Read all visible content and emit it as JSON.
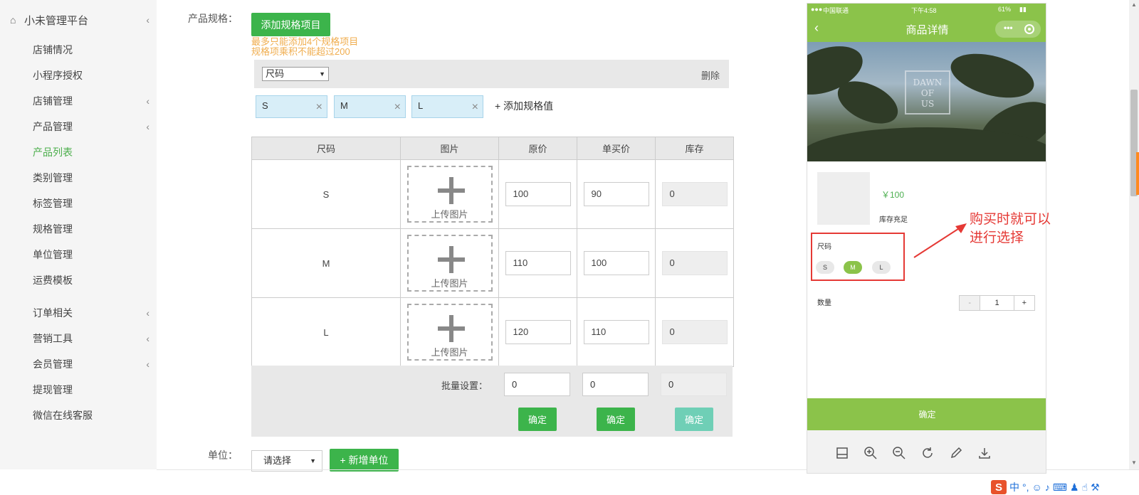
{
  "sidebar": {
    "brand": "小未管理平台",
    "items": [
      {
        "label": "店铺情况"
      },
      {
        "label": "小程序授权"
      },
      {
        "label": "店铺管理"
      },
      {
        "label": "产品管理"
      },
      {
        "label": "产品列表"
      },
      {
        "label": "类别管理"
      },
      {
        "label": "标签管理"
      },
      {
        "label": "规格管理"
      },
      {
        "label": "单位管理"
      },
      {
        "label": "运费模板"
      },
      {
        "label": "订单相关"
      },
      {
        "label": "营销工具"
      },
      {
        "label": "会员管理"
      },
      {
        "label": "提现管理"
      },
      {
        "label": "微信在线客服"
      }
    ]
  },
  "form": {
    "spec_label": "产品规格：",
    "add_spec_button": "添加规格项目",
    "hint_1": "最多只能添加4个规格项目",
    "hint_2": "规格项乘积不能超过200",
    "spec_select_value": "尺码",
    "delete_label": "删除",
    "tags": [
      "S",
      "M",
      "L"
    ],
    "add_value_label": "+ 添加规格值",
    "unit_label": "单位：",
    "unit_select_value": "请选择",
    "add_unit_button": "+ 新增单位"
  },
  "table": {
    "headers": [
      "尺码",
      "图片",
      "原价",
      "单买价",
      "库存"
    ],
    "upload_label": "上传图片",
    "rows": [
      {
        "size": "S",
        "price": "100",
        "single": "90",
        "stock": "0"
      },
      {
        "size": "M",
        "price": "110",
        "single": "100",
        "stock": "0"
      },
      {
        "size": "L",
        "price": "120",
        "single": "110",
        "stock": "0"
      }
    ],
    "batch_label": "批量设置：",
    "batch_values": [
      "0",
      "0",
      "0"
    ],
    "confirm_label": "确定"
  },
  "phone": {
    "status_carrier": "中国联通",
    "status_time": "下午4:58",
    "status_battery": "61%",
    "nav_title": "商品详情",
    "logo_lines": [
      "DAWN",
      "OF",
      "US"
    ],
    "price": "￥100",
    "stock": "库存充足",
    "spec_title": "尺码",
    "options": [
      "S",
      "M",
      "L"
    ],
    "selected_option": "M",
    "qty_title": "数量",
    "qty_minus": "-",
    "qty_value": "1",
    "qty_plus": "+",
    "confirm": "确定"
  },
  "annotation": {
    "line_1": "购买时就可以",
    "line_2": "进行选择",
    "color": "#e53935"
  },
  "ime": {
    "logo": "S",
    "lang": "中"
  },
  "colors": {
    "accent": "#3cb44b",
    "phone_theme": "#8bc34a",
    "hint": "#f0ad4e"
  }
}
